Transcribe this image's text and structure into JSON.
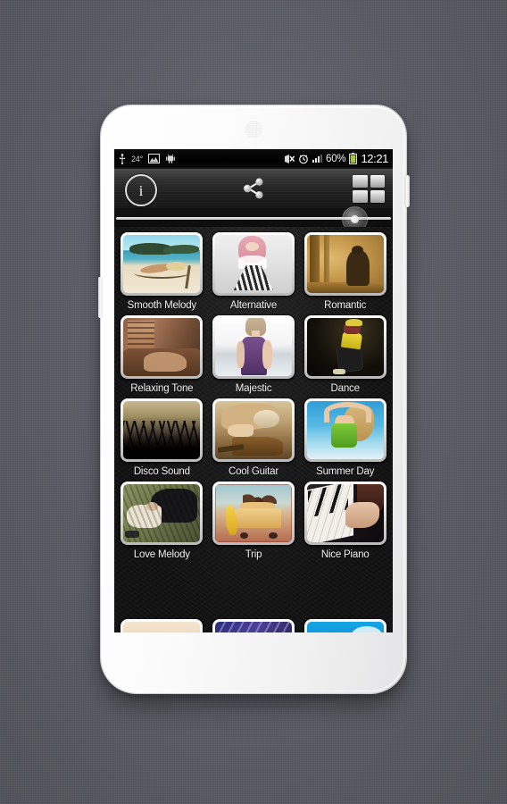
{
  "statusbar": {
    "usb_icon": "usb-icon",
    "temperature": "24°",
    "gallery_icon": "image-icon",
    "android_icon": "android-robot-icon",
    "mute_icon": "mute-icon",
    "alarm_icon": "alarm-clock-icon",
    "signal_icon": "signal-bars-icon",
    "battery_percent": "60%",
    "battery_icon": "battery-icon",
    "clock": "12:21"
  },
  "toolbar": {
    "info_label": "i",
    "info_name": "info-button",
    "share_name": "share-button",
    "grid_name": "grid-view-button"
  },
  "slider": {
    "name": "zoom-slider",
    "handle_position_pct": 88
  },
  "grid": {
    "tiles": [
      {
        "label": "Smooth Melody",
        "art": "art-beach"
      },
      {
        "label": "Alternative",
        "art": "art-alt"
      },
      {
        "label": "Romantic",
        "art": "art-romantic"
      },
      {
        "label": "Relaxing Tone",
        "art": "art-relax"
      },
      {
        "label": "Majestic",
        "art": "art-majestic"
      },
      {
        "label": "Dance",
        "art": "art-dance"
      },
      {
        "label": "Disco Sound",
        "art": "art-disco"
      },
      {
        "label": "Cool Guitar",
        "art": "art-guitar"
      },
      {
        "label": "Summer Day",
        "art": "art-summer"
      },
      {
        "label": "Love Melody",
        "art": "art-love"
      },
      {
        "label": "Trip",
        "art": "art-trip"
      },
      {
        "label": "Nice Piano",
        "art": "art-piano"
      }
    ],
    "partial_row": [
      {
        "label": "",
        "art": "art-cream"
      },
      {
        "label": "",
        "art": "art-purple"
      },
      {
        "label": "",
        "art": "art-blue"
      }
    ]
  },
  "navbar": {
    "back_name": "back-button",
    "home_name": "home-button",
    "recents_name": "recents-button"
  },
  "colors": {
    "page_background": "#5e6169",
    "device_body": "#ffffff",
    "statusbar_background": "#000000",
    "toolbar_gradient_top": "#4a4a4a",
    "toolbar_gradient_bottom": "#171717",
    "content_background": "#161616",
    "tile_frame": "#ffffff",
    "label_text": "#f0f0f0",
    "accent_battery": "#8bc34a"
  }
}
